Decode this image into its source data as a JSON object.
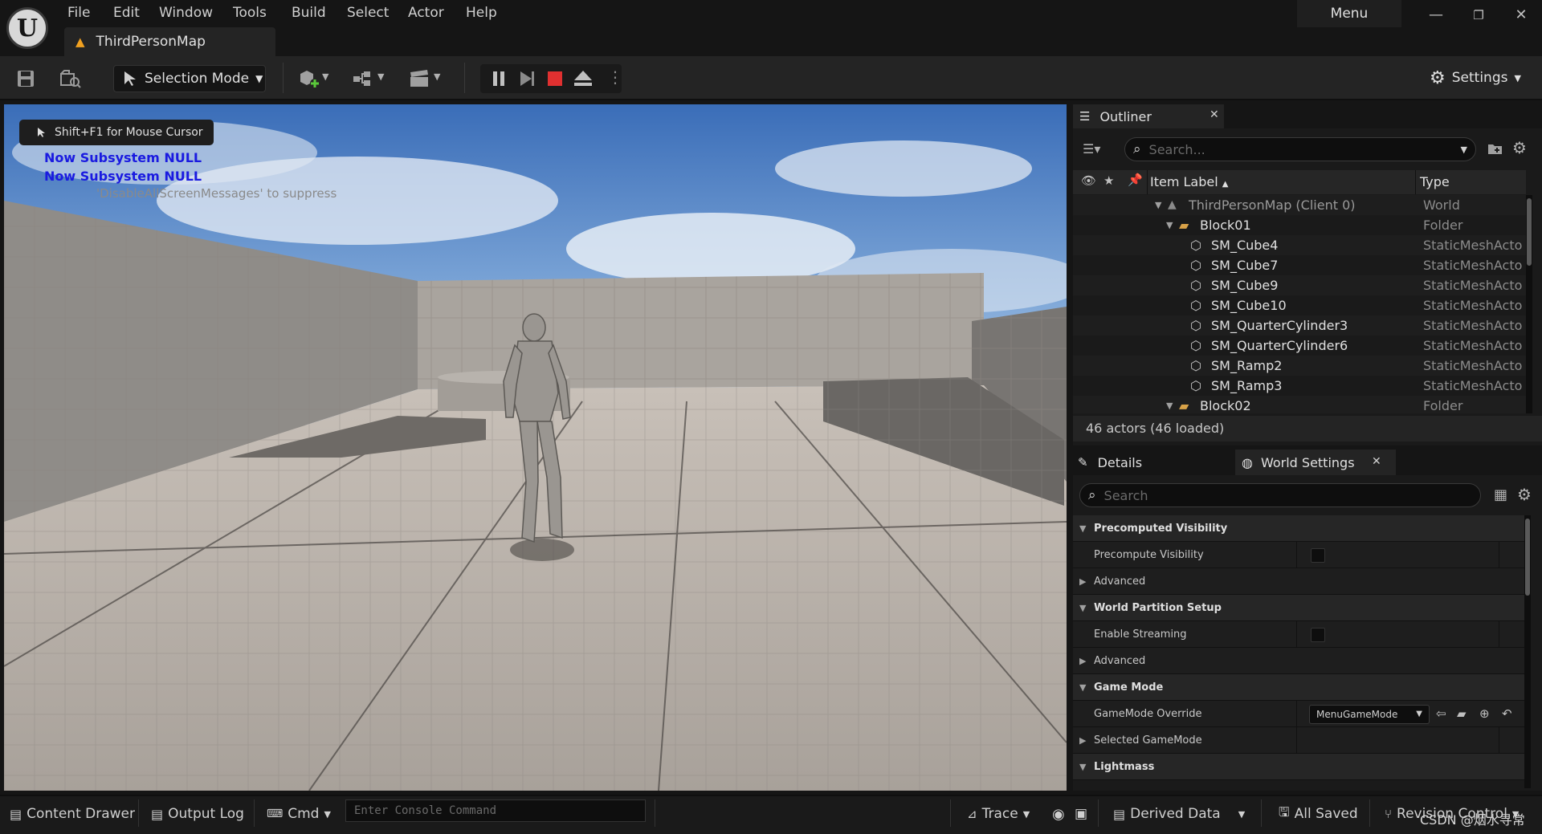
{
  "menubar": {
    "items": [
      "File",
      "Edit",
      "Window",
      "Tools",
      "Build",
      "Select",
      "Actor",
      "Help"
    ],
    "menu_button": "Menu"
  },
  "document_tab": {
    "label": "ThirdPersonMap"
  },
  "toolbar": {
    "selection_mode": "Selection Mode",
    "settings": "Settings"
  },
  "viewport": {
    "hint": "Shift+F1 for Mouse Cursor",
    "messages": [
      "Now Subsystem NULL",
      "Now Subsystem NULL"
    ],
    "suppress_note": "'DisableAllScreenMessages' to suppress"
  },
  "outliner": {
    "tab_label": "Outliner",
    "search_placeholder": "Search...",
    "header": {
      "item_label": "Item Label",
      "type": "Type"
    },
    "rows": [
      {
        "label": "ThirdPersonMap (Client 0)",
        "type": "World"
      },
      {
        "label": "Block01",
        "type": "Folder"
      },
      {
        "label": "SM_Cube4",
        "type": "StaticMeshActo"
      },
      {
        "label": "SM_Cube7",
        "type": "StaticMeshActo"
      },
      {
        "label": "SM_Cube9",
        "type": "StaticMeshActo"
      },
      {
        "label": "SM_Cube10",
        "type": "StaticMeshActo"
      },
      {
        "label": "SM_QuarterCylinder3",
        "type": "StaticMeshActo"
      },
      {
        "label": "SM_QuarterCylinder6",
        "type": "StaticMeshActo"
      },
      {
        "label": "SM_Ramp2",
        "type": "StaticMeshActo"
      },
      {
        "label": "SM_Ramp3",
        "type": "StaticMeshActo"
      },
      {
        "label": "Block02",
        "type": "Folder"
      }
    ],
    "footer": "46 actors (46 loaded)"
  },
  "details": {
    "tab_details": "Details",
    "tab_world_settings": "World Settings",
    "search_placeholder": "Search",
    "rows": [
      {
        "kind": "cat",
        "name": "Precomputed Visibility"
      },
      {
        "kind": "prop",
        "name": "Precompute Visibility"
      },
      {
        "kind": "prop",
        "name": "Advanced"
      },
      {
        "kind": "cat",
        "name": "World Partition Setup"
      },
      {
        "kind": "prop",
        "name": "Enable Streaming"
      },
      {
        "kind": "prop",
        "name": "Advanced"
      },
      {
        "kind": "cat",
        "name": "Game Mode"
      },
      {
        "kind": "prop",
        "name": "GameMode Override"
      },
      {
        "kind": "prop",
        "name": "Selected GameMode"
      },
      {
        "kind": "cat",
        "name": "Lightmass"
      }
    ],
    "gamemode_value": "MenuGameMode"
  },
  "statusbar": {
    "content_drawer": "Content Drawer",
    "output_log": "Output Log",
    "cmd": "Cmd",
    "console_placeholder": "Enter Console Command",
    "trace": "Trace",
    "derived_data": "Derived Data",
    "all_saved": "All Saved",
    "revision_control": "Revision Control",
    "watermark": "CSDN @烟水寻常"
  },
  "colors": {
    "accent_warning": "#f0a020",
    "stop_red": "#e03030",
    "message_blue": "#1a1ae0"
  }
}
